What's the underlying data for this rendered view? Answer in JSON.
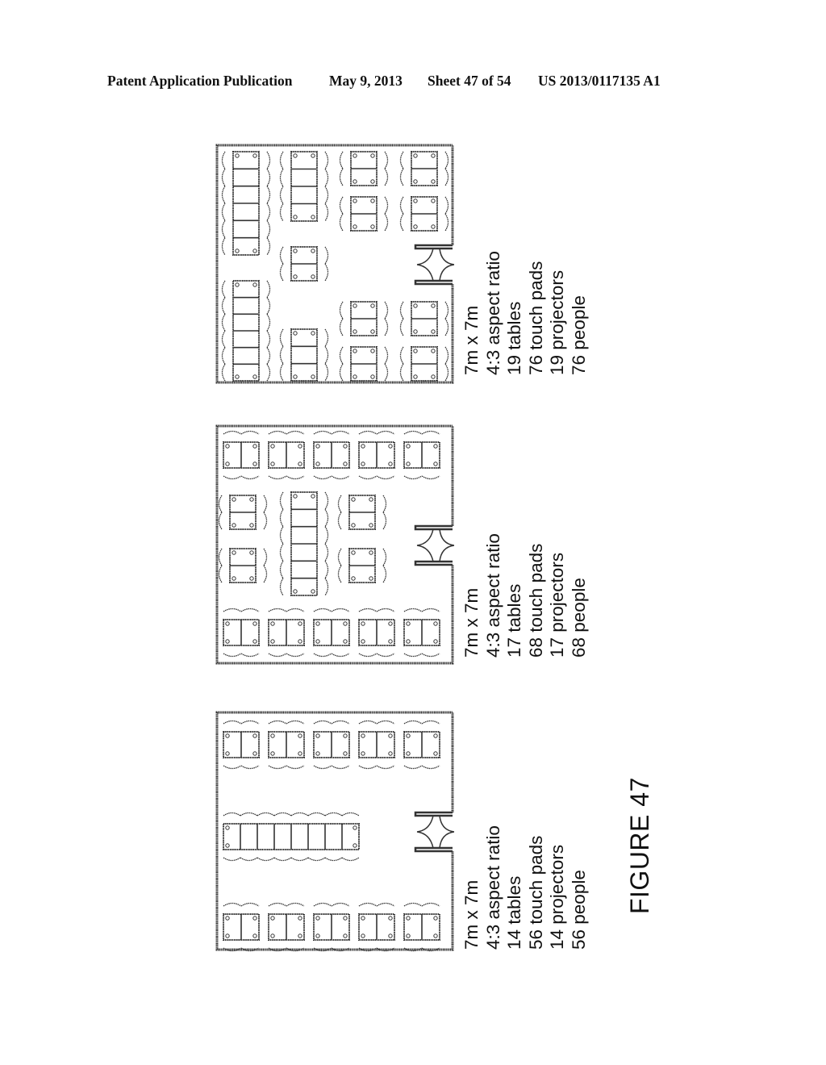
{
  "header": {
    "title": "Patent Application Publication",
    "date": "May 9, 2013",
    "sheet": "Sheet 47 of 54",
    "number": "US 2013/0117135 A1"
  },
  "figure_label": "FIGURE 47",
  "layouts": [
    {
      "id": "layout-a",
      "caption": [
        "7m x 7m",
        "4:3 aspect ratio",
        "19 tables",
        "76 touch pads",
        "19 projectors",
        "76 people"
      ]
    },
    {
      "id": "layout-b",
      "caption": [
        "7m x 7m",
        "4:3 aspect ratio",
        "17 tables",
        "68 touch pads",
        "17 projectors",
        "68 people"
      ]
    },
    {
      "id": "layout-c",
      "caption": [
        "7m x 7m",
        "4:3 aspect ratio",
        "14 tables",
        "56 touch pads",
        "14 projectors",
        "56 people"
      ]
    }
  ],
  "colors": {
    "ink": "#333333",
    "paper": "#ffffff"
  }
}
